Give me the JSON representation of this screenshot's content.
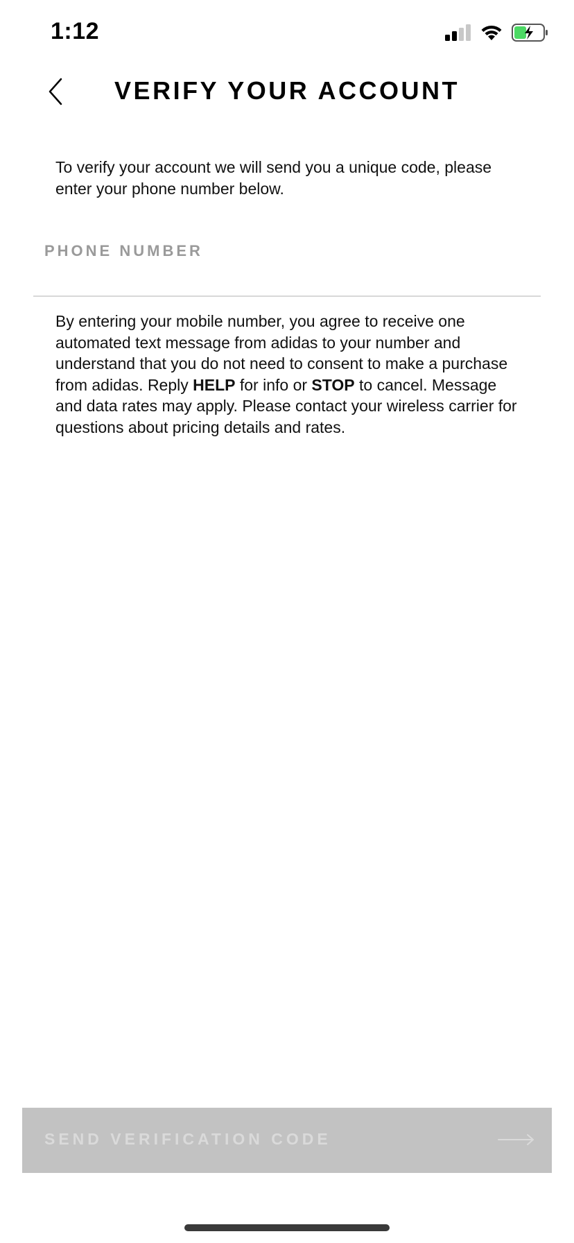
{
  "status_bar": {
    "time": "1:12",
    "signal_icon": "cellular-signal-icon",
    "wifi_icon": "wifi-icon",
    "battery_icon": "battery-charging-icon"
  },
  "header": {
    "back_icon": "chevron-left-icon",
    "title": "VERIFY YOUR ACCOUNT"
  },
  "intro": {
    "text": "To verify your account we will send you a unique code, please enter your phone number below."
  },
  "phone_field": {
    "value": "",
    "placeholder": "PHONE NUMBER"
  },
  "consent": {
    "part1": "By entering your mobile number, you agree to receive one automated text message from adidas to your number and understand that you do not need to consent to make a purchase from adidas. Reply ",
    "help_keyword": "HELP",
    "part2": " for info or ",
    "stop_keyword": "STOP",
    "part3": " to cancel. Message and data rates may apply. Please contact your wireless carrier for questions about pricing details and rates."
  },
  "send_button": {
    "label": "SEND VERIFICATION CODE",
    "icon": "arrow-right-icon"
  },
  "colors": {
    "button_disabled_bg": "#c2c2c2",
    "button_disabled_text": "#dadada",
    "battery_fill": "#4cd964"
  }
}
